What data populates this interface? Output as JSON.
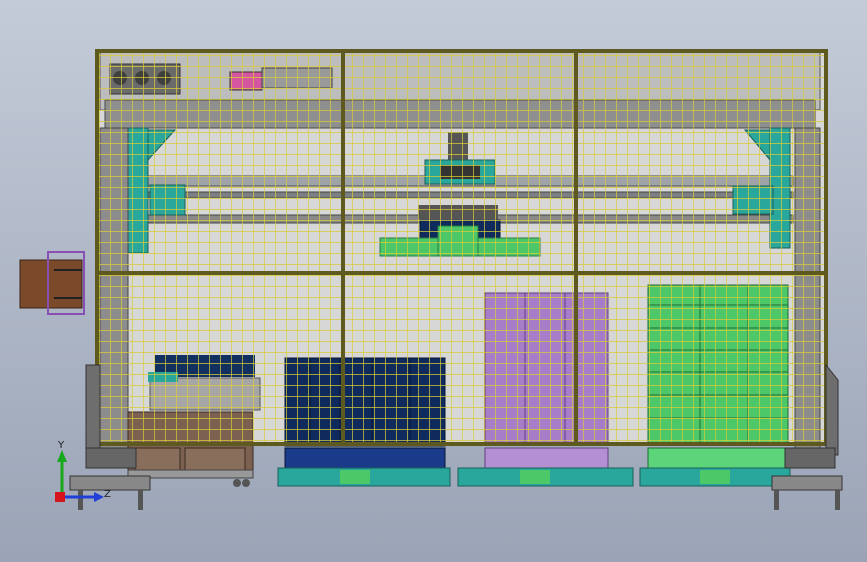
{
  "triad": {
    "y_label": "Y",
    "z_label": "Z",
    "y_color": "#17a81c",
    "z_color": "#1f3fd6",
    "origin_color": "#d6141e"
  },
  "colors": {
    "frame": "#5e5a1f",
    "grid": "#d6c93a",
    "teal": "#2aa79c",
    "navy": "#0f2a5c",
    "purple": "#a77cc9",
    "green": "#4cc869",
    "brown": "#8a5a3a",
    "grey": "#8d8d8d",
    "panel": "#d9d9d9"
  }
}
